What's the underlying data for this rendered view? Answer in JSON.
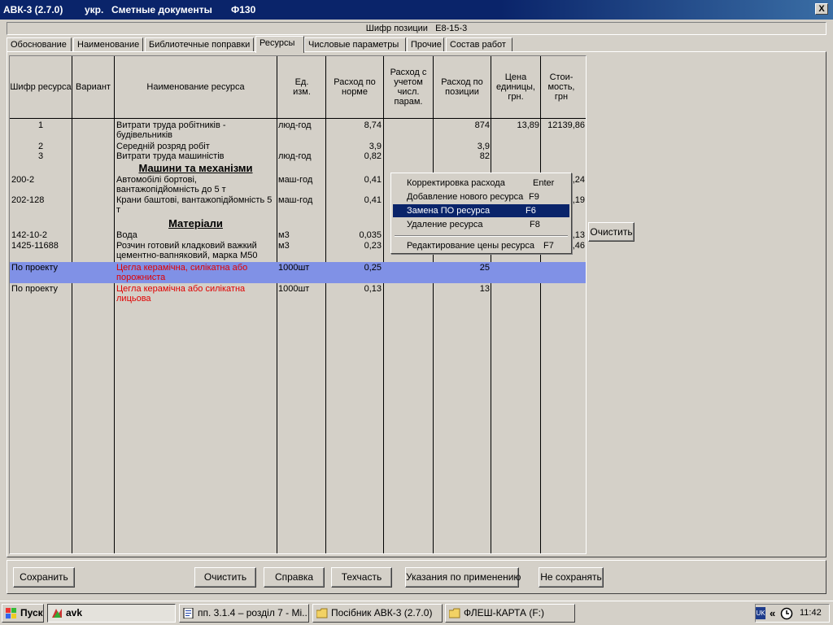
{
  "window": {
    "title_app": "АВК-3 (2.7.0)",
    "title_lang": "укр.",
    "title_doc": "Сметные документы",
    "title_code": "Ф130",
    "close_label": "X"
  },
  "position": {
    "label": "Шифр позиции",
    "value": "Е8-15-3"
  },
  "tabs": [
    {
      "label": "Обоснование"
    },
    {
      "label": "Наименование"
    },
    {
      "label": "Библиотечные поправки"
    },
    {
      "label": "Ресурсы"
    },
    {
      "label": "Числовые параметры"
    },
    {
      "label": "Прочие"
    },
    {
      "label": "Состав работ"
    }
  ],
  "table": {
    "headers": [
      "Шифр ресурса",
      "Вариант",
      "Наименование ресурса",
      "Ед. изм.",
      "Расход по норме",
      "Расход с учетом числ. парам.",
      "Расход по позиции",
      "Цена единицы, грн.",
      "Стои-мость, грн"
    ],
    "rows": [
      {
        "code": "1",
        "name": "Витрати труда робітників - будівельників",
        "unit": "люд-год",
        "norm": "8,74",
        "calc": "",
        "pos": "874",
        "price": "13,89",
        "cost": "12139,86"
      },
      {
        "code": "2",
        "name": "Середній розряд робіт",
        "unit": "",
        "norm": "3,9",
        "calc": "",
        "pos": "3,9",
        "price": "",
        "cost": ""
      },
      {
        "code": "3",
        "name": "Витрати труда машиністів",
        "unit": "люд-год",
        "norm": "0,82",
        "calc": "",
        "pos": "82",
        "price": "",
        "cost": ""
      },
      {
        "code": "200-2",
        "name": "Автомобілі бортові, вантажопідйомність до 5 т",
        "unit": "маш-год",
        "norm": "0,41",
        "calc": "",
        "pos": "",
        "price": "",
        "cost": ",24"
      },
      {
        "code": "202-128",
        "name": "Крани баштові, вантажопідйомність 5 т",
        "unit": "маш-год",
        "norm": "0,41",
        "calc": "",
        "pos": "",
        "price": "",
        "cost": ",19"
      },
      {
        "code": "142-10-2",
        "name": "Вода",
        "unit": "м3",
        "norm": "0,035",
        "calc": "",
        "pos": "",
        "price": "",
        "cost": ",13"
      },
      {
        "code": "1425-11688",
        "name": "Розчин готовий кладковий важкий цементно-вапняковий, марка М50",
        "unit": "м3",
        "norm": "0,23",
        "calc": "",
        "pos": "",
        "price": "",
        "cost": ",46"
      },
      {
        "code": "По проекту",
        "name": "Цегла керамічна, силікатна або порожниста",
        "unit": "1000шт",
        "norm": "0,25",
        "calc": "",
        "pos": "25",
        "price": "",
        "cost": ""
      },
      {
        "code": "По проекту",
        "name": "Цегла керамічна або силікатна лицьова",
        "unit": "1000шт",
        "norm": "0,13",
        "calc": "",
        "pos": "13",
        "price": "",
        "cost": ""
      }
    ],
    "sections": {
      "machines": "Машини та механізми",
      "materials": "Матеріали"
    }
  },
  "context_menu": [
    {
      "label": "Корректировка расхода",
      "key": "Enter"
    },
    {
      "label": "Добавление нового ресурса",
      "key": "F9"
    },
    {
      "label": "Замена ПО ресурса",
      "key": "F6"
    },
    {
      "label": "Удаление ресурса",
      "key": "F8"
    },
    {
      "label": "Редактирование цены ресурса",
      "key": "F7"
    }
  ],
  "side_clear_label": "Очистить",
  "buttons": {
    "save": "Сохранить",
    "clear": "Очистить",
    "help": "Справка",
    "techpart": "Техчасть",
    "instructions": "Указания по применению",
    "no_save": "Не сохранять"
  },
  "taskbar": {
    "start": "Пуск",
    "tasks": [
      {
        "label": "avk"
      },
      {
        "label": "пп. 3.1.4 – розділ 7 - Mi..."
      },
      {
        "label": "Посібник АВК-3 (2.7.0)"
      },
      {
        "label": "ФЛЕШ-КАРТА (F:)"
      }
    ],
    "lang": "UK",
    "chevron": "«",
    "clock": "11:42"
  },
  "colors": {
    "title_bg": "#0a246a",
    "face": "#d4d0c8",
    "selection_row": "#8091e6",
    "menu_highlight": "#0a246a",
    "red_text": "#e00000"
  }
}
